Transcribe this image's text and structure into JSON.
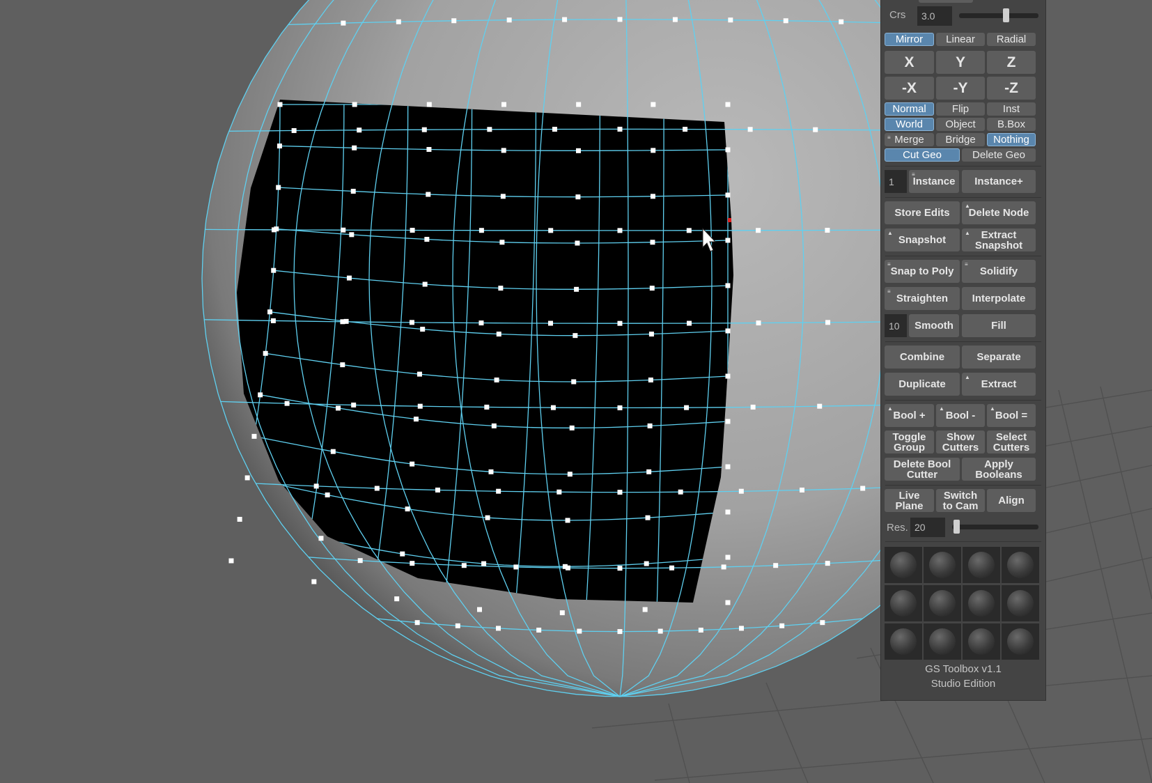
{
  "colors": {
    "viewport_bg": "#5f5f5f",
    "wire": "#5fd0f0",
    "hole": "#000000",
    "panel_bg": "#444444",
    "button": "#5d5d5d",
    "active": "#5a86ad"
  },
  "toolbox": {
    "crs_label": "Crs",
    "crs_value": "3.0",
    "crs_slider": 0.5,
    "mode": {
      "mirror": "Mirror",
      "linear": "Linear",
      "radial": "Radial"
    },
    "axes": {
      "x": "X",
      "y": "Y",
      "z": "Z",
      "nx": "-X",
      "ny": "-Y",
      "nz": "-Z"
    },
    "orient": {
      "normal": "Normal",
      "flip": "Flip",
      "inst": "Inst"
    },
    "space": {
      "world": "World",
      "object": "Object",
      "bbox": "B.Box"
    },
    "merge_mode": {
      "merge": "Merge",
      "bridge": "Bridge",
      "nothing": "Nothing"
    },
    "geo": {
      "cut": "Cut Geo",
      "delete": "Delete Geo"
    },
    "instance_count": "1",
    "instance": "Instance",
    "instance_plus": "Instance+",
    "store_edits": "Store Edits",
    "delete_node": "Delete Node",
    "snapshot": "Snapshot",
    "extract_snapshot": "Extract\nSnapshot",
    "snap_to_poly": "Snap to Poly",
    "solidify": "Solidify",
    "straighten": "Straighten",
    "interpolate": "Interpolate",
    "smooth_count": "10",
    "smooth": "Smooth",
    "fill": "Fill",
    "combine": "Combine",
    "separate": "Separate",
    "duplicate": "Duplicate",
    "extract": "Extract",
    "bool_plus": "Bool +",
    "bool_minus": "Bool -",
    "bool_eq": "Bool =",
    "toggle_group": "Toggle\nGroup",
    "show_cutters": "Show\nCutters",
    "select_cutters": "Select\nCutters",
    "delete_bool_cutter": "Delete Bool\nCutter",
    "apply_booleans": "Apply\nBooleans",
    "live_plane": "Live\nPlane",
    "switch_to_cam": "Switch\nto Cam",
    "align": "Align",
    "res_label": "Res.",
    "res_value": "20",
    "res_slider": 0.02,
    "footer_title": "GS Toolbox v1.1",
    "footer_edition": "Studio Edition"
  }
}
